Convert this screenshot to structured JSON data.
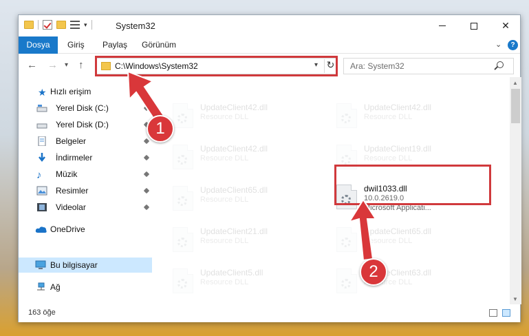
{
  "window": {
    "title": "System32",
    "controls": {
      "minimize": "minimize",
      "maximize": "maximize",
      "close": "✕"
    }
  },
  "ribbon": {
    "tabs": [
      "Dosya",
      "Giriş",
      "Paylaş",
      "Görünüm"
    ],
    "help": "?"
  },
  "navigation": {
    "address": "C:\\Windows\\System32",
    "search_placeholder": "Ara: System32"
  },
  "sidebar": {
    "items": [
      {
        "label": "Hızlı erişim",
        "icon": "star-icon"
      },
      {
        "label": "Yerel Disk (C:)",
        "icon": "drive-icon",
        "pinned": true
      },
      {
        "label": "Yerel Disk (D:)",
        "icon": "drive-icon",
        "pinned": true
      },
      {
        "label": "Belgeler",
        "icon": "documents-icon",
        "pinned": true
      },
      {
        "label": "İndirmeler",
        "icon": "downloads-icon",
        "pinned": true
      },
      {
        "label": "Müzik",
        "icon": "music-icon",
        "pinned": true
      },
      {
        "label": "Resimler",
        "icon": "pictures-icon",
        "pinned": true
      },
      {
        "label": "Videolar",
        "icon": "videos-icon",
        "pinned": true
      },
      {
        "label": "OneDrive",
        "icon": "cloud-icon"
      },
      {
        "label": "Bu bilgisayar",
        "icon": "computer-icon",
        "selected": true
      },
      {
        "label": "Ağ",
        "icon": "network-icon"
      }
    ]
  },
  "files": [
    {
      "name": "UpdateClient42.dll",
      "desc": "Resource DLL",
      "faded": true
    },
    {
      "name": "UpdateClient42.dll",
      "desc": "Resource DLL",
      "faded": true
    },
    {
      "name": "UpdateClient42.dll",
      "desc": "Resource DLL",
      "faded": true
    },
    {
      "name": "UpdateClient19.dll",
      "desc": "Resource DLL",
      "faded": true
    },
    {
      "name": "UpdateClient65.dll",
      "desc": "Resource DLL",
      "faded": true
    },
    {
      "name": "dwil1033.dll",
      "desc": "10.0.2619.0",
      "desc2": "Microsoft Applicati...",
      "faded": false
    },
    {
      "name": "UpdateClient21.dll",
      "desc": "Resource DLL",
      "faded": true
    },
    {
      "name": "UpdateClient65.dll",
      "desc": "Resource DLL",
      "faded": true
    },
    {
      "name": "UpdateClient5.dll",
      "desc": "Resource DLL",
      "faded": true
    },
    {
      "name": "UpdateClient63.dll",
      "desc": "Resource DLL",
      "faded": true
    }
  ],
  "status": {
    "count": "163 öğe"
  },
  "annotations": {
    "marker1": "1",
    "marker2": "2",
    "highlight_color": "#d0393c"
  }
}
